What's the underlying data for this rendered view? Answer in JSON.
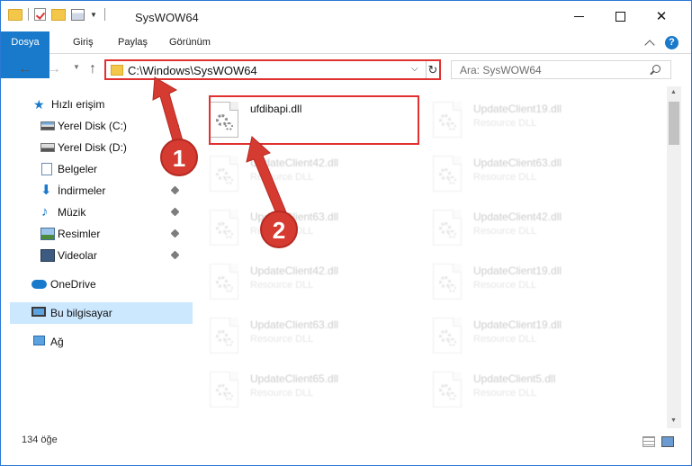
{
  "window": {
    "title": "SysWOW64",
    "controls": {
      "minimize": "minimize",
      "maximize": "maximize",
      "close": "✕"
    }
  },
  "ribbon": {
    "tabs": [
      "Dosya",
      "Giriş",
      "Paylaş",
      "Görünüm"
    ],
    "help": "?"
  },
  "address": {
    "path": "C:\\Windows\\SysWOW64",
    "search_placeholder": "Ara: SysWOW64"
  },
  "nav": {
    "quick_access": "Hızlı erişim",
    "items": [
      {
        "label": "Yerel Disk (C:)",
        "pinned": true
      },
      {
        "label": "Yerel Disk (D:)",
        "pinned": false
      },
      {
        "label": "Belgeler",
        "pinned": true
      },
      {
        "label": "İndirmeler",
        "pinned": true
      },
      {
        "label": "Müzik",
        "pinned": true
      },
      {
        "label": "Resimler",
        "pinned": true
      },
      {
        "label": "Videolar",
        "pinned": true
      }
    ],
    "onedrive": "OneDrive",
    "this_pc": "Bu bilgisayar",
    "network": "Ağ"
  },
  "files": {
    "highlighted": {
      "name": "ufdibapi.dll"
    },
    "left_column": [
      {
        "name": "UpdateClient42.dll",
        "type": "Resource DLL"
      },
      {
        "name": "UpdateClient63.dll",
        "type": "Resource DLL"
      },
      {
        "name": "UpdateClient42.dll",
        "type": "Resource DLL"
      },
      {
        "name": "UpdateClient63.dll",
        "type": "Resource DLL"
      },
      {
        "name": "UpdateClient65.dll",
        "type": "Resource DLL"
      }
    ],
    "right_column": [
      {
        "name": "UpdateClient19.dll",
        "type": "Resource DLL"
      },
      {
        "name": "UpdateClient63.dll",
        "type": "Resource DLL"
      },
      {
        "name": "UpdateClient42.dll",
        "type": "Resource DLL"
      },
      {
        "name": "UpdateClient19.dll",
        "type": "Resource DLL"
      },
      {
        "name": "UpdateClient19.dll",
        "type": "Resource DLL"
      },
      {
        "name": "UpdateClient5.dll",
        "type": "Resource DLL"
      }
    ]
  },
  "status": {
    "item_count": "134 öğe"
  },
  "annotations": {
    "badge1": "1",
    "badge2": "2",
    "color": "#d63b32"
  }
}
